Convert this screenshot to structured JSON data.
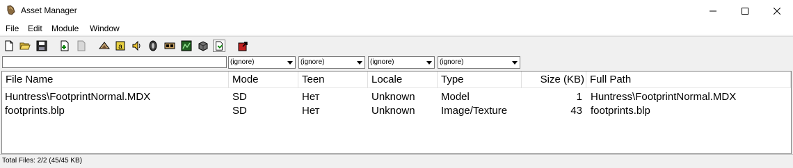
{
  "window": {
    "title": "Asset Manager",
    "controls": [
      "minimize",
      "maximize",
      "close"
    ]
  },
  "menu": [
    {
      "label": "File"
    },
    {
      "label": "Edit"
    },
    {
      "label": "Module"
    },
    {
      "label": "Window"
    }
  ],
  "toolbar": {
    "buttons": [
      {
        "icon": "new-document-icon"
      },
      {
        "icon": "open-folder-icon"
      },
      {
        "icon": "save-disk-icon"
      },
      {
        "icon": "add-file-icon"
      },
      {
        "icon": "remove-file-icon"
      },
      {
        "icon": "model-filter-icon"
      },
      {
        "icon": "texture-filter-icon"
      },
      {
        "icon": "sound-filter-icon"
      },
      {
        "icon": "script-filter-icon"
      },
      {
        "icon": "image-filter-icon"
      },
      {
        "icon": "map-filter-icon"
      },
      {
        "icon": "archive-box-icon"
      },
      {
        "icon": "show-all-files-icon",
        "pressed": true
      },
      {
        "icon": "export-icon"
      }
    ]
  },
  "filters": {
    "search_value": "",
    "selects": [
      {
        "name": "mode-filter",
        "value": "(ignore)"
      },
      {
        "name": "teen-filter",
        "value": "(ignore)"
      },
      {
        "name": "locale-filter",
        "value": "(ignore)"
      },
      {
        "name": "type-filter",
        "value": "(ignore)"
      }
    ]
  },
  "table": {
    "columns": [
      "File Name",
      "Mode",
      "Teen",
      "Locale",
      "Type",
      "Size (KB)",
      "Full Path"
    ],
    "rows": [
      [
        "Huntress\\FootprintNormal.MDX",
        "SD",
        "Нет",
        "Unknown",
        "Model",
        "1",
        "Huntress\\FootprintNormal.MDX"
      ],
      [
        "footprints.blp",
        "SD",
        "Нет",
        "Unknown",
        "Image/Texture",
        "43",
        "footprints.blp"
      ]
    ]
  },
  "status": {
    "text": "Total Files: 2/2 (45/45 KB)"
  }
}
